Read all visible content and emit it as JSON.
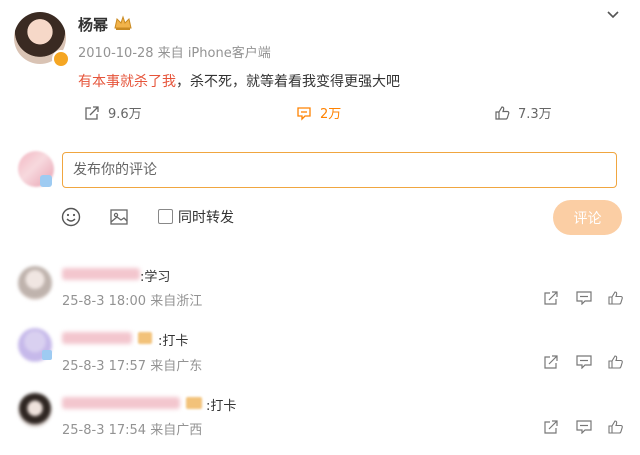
{
  "post": {
    "username": "杨幂",
    "crown_icon": "crown-icon",
    "meta": "2010-10-28  来自 iPhone客户端",
    "content_highlight": "有本事就杀了我",
    "content_rest": "，杀不死，就等着看我变得更强大吧",
    "actions": {
      "share_count": "9.6万",
      "comment_count": "2万",
      "like_count": "7.3万"
    }
  },
  "composer": {
    "placeholder": "发布你的评论",
    "repost_label": "同时转发",
    "submit_label": "评论"
  },
  "comments": [
    {
      "text": ":学习",
      "meta": "25-8-3 18:00  来自浙江"
    },
    {
      "text": ":打卡",
      "meta": "25-8-3 17:57  来自广东"
    },
    {
      "text": ":打卡",
      "meta": "25-8-3 17:54  来自广西"
    }
  ],
  "colors": {
    "accent": "#ff8200",
    "highlight_text": "#e6543a",
    "input_border": "#f0a640",
    "submit_bg": "#fbcea4",
    "meta_gray": "#939393"
  }
}
